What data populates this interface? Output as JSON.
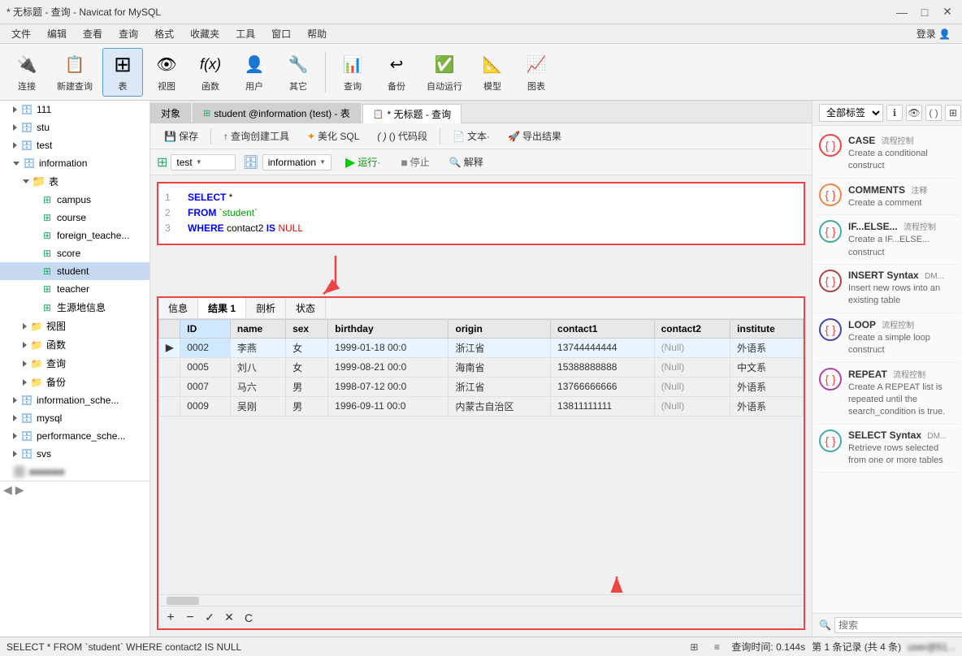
{
  "titlebar": {
    "title": "* 无标题 - 查询 - Navicat for MySQL",
    "min_btn": "—",
    "max_btn": "□",
    "close_btn": "✕"
  },
  "menubar": {
    "items": [
      "文件",
      "编辑",
      "查看",
      "查询",
      "格式",
      "收藏夹",
      "工具",
      "窗口",
      "帮助"
    ],
    "login": "登录"
  },
  "toolbar": {
    "items": [
      {
        "label": "连接",
        "icon": "🔌"
      },
      {
        "label": "新建查询",
        "icon": "📋"
      },
      {
        "label": "表",
        "icon": "⊞",
        "active": true
      },
      {
        "label": "视图",
        "icon": "👁"
      },
      {
        "label": "函数",
        "icon": "ƒ(x)"
      },
      {
        "label": "用户",
        "icon": "👤"
      },
      {
        "label": "其它",
        "icon": "🔧"
      },
      {
        "label": "查询",
        "icon": "📊"
      },
      {
        "label": "备份",
        "icon": "↩"
      },
      {
        "label": "自动运行",
        "icon": "✅"
      },
      {
        "label": "模型",
        "icon": "📐"
      },
      {
        "label": "图表",
        "icon": "📈"
      }
    ]
  },
  "sidebar": {
    "items": [
      {
        "label": "111",
        "level": 0,
        "type": "db",
        "collapsed": true
      },
      {
        "label": "stu",
        "level": 0,
        "type": "db",
        "collapsed": true
      },
      {
        "label": "test",
        "level": 0,
        "type": "db",
        "collapsed": true
      },
      {
        "label": "information",
        "level": 0,
        "type": "db",
        "collapsed": false
      },
      {
        "label": "表",
        "level": 1,
        "type": "folder",
        "collapsed": false
      },
      {
        "label": "campus",
        "level": 2,
        "type": "table"
      },
      {
        "label": "course",
        "level": 2,
        "type": "table"
      },
      {
        "label": "foreign_teache...",
        "level": 2,
        "type": "table"
      },
      {
        "label": "score",
        "level": 2,
        "type": "table"
      },
      {
        "label": "student",
        "level": 2,
        "type": "table",
        "selected": true
      },
      {
        "label": "teacher",
        "level": 2,
        "type": "table"
      },
      {
        "label": "生源地信息",
        "level": 2,
        "type": "table"
      },
      {
        "label": "视图",
        "level": 1,
        "type": "folder",
        "collapsed": true
      },
      {
        "label": "函数",
        "level": 1,
        "type": "folder",
        "collapsed": true
      },
      {
        "label": "查询",
        "level": 1,
        "type": "folder",
        "collapsed": true
      },
      {
        "label": "备份",
        "level": 1,
        "type": "folder",
        "collapsed": true
      },
      {
        "label": "information_sche...",
        "level": 0,
        "type": "db",
        "collapsed": true
      },
      {
        "label": "mysql",
        "level": 0,
        "type": "db",
        "collapsed": true
      },
      {
        "label": "performance_sche...",
        "level": 0,
        "type": "db",
        "collapsed": true
      },
      {
        "label": "svs",
        "level": 0,
        "type": "db",
        "collapsed": true
      },
      {
        "label": "...",
        "level": 0,
        "type": "more"
      }
    ]
  },
  "tabs": [
    {
      "label": "对象",
      "icon": "",
      "active": false
    },
    {
      "label": "student @information (test) - 表",
      "icon": "🟩",
      "active": false
    },
    {
      "label": "* 无标题 - 查询",
      "icon": "📋",
      "active": true
    }
  ],
  "action_bar": {
    "save": "保存",
    "query_builder": "查询创建工具",
    "beautify": "美化 SQL",
    "snippet": "() 代码段",
    "text": "文本·",
    "export": "导出结果"
  },
  "query_toolbar": {
    "db1": "test",
    "db2": "information",
    "run": "运行·",
    "stop": "停止",
    "explain": "解释"
  },
  "sql_editor": {
    "lines": [
      {
        "num": "1",
        "text": "SELECT *"
      },
      {
        "num": "2",
        "text": "FROM `student`"
      },
      {
        "num": "3",
        "text": "WHERE  contact2 IS NULL"
      }
    ]
  },
  "results_tabs": [
    "信息",
    "结果 1",
    "剖析",
    "状态"
  ],
  "results_active_tab": "结果 1",
  "table": {
    "headers": [
      "ID",
      "name",
      "sex",
      "birthday",
      "origin",
      "contact1",
      "contact2",
      "institute"
    ],
    "rows": [
      {
        "indicator": "▶",
        "id": "0002",
        "name": "李燕",
        "sex": "女",
        "birthday": "1999-01-18 00:0",
        "origin": "浙江省",
        "contact1": "13744444444",
        "contact2": "(Null)",
        "institute": "外语系"
      },
      {
        "indicator": "",
        "id": "0005",
        "name": "刘八",
        "sex": "女",
        "birthday": "1999-08-21 00:0",
        "origin": "海南省",
        "contact1": "15388888888",
        "contact2": "(Null)",
        "institute": "中文系"
      },
      {
        "indicator": "",
        "id": "0007",
        "name": "马六",
        "sex": "男",
        "birthday": "1998-07-12 00:0",
        "origin": "浙江省",
        "contact1": "13766666666",
        "contact2": "(Null)",
        "institute": "外语系"
      },
      {
        "indicator": "",
        "id": "0009",
        "name": "吴刚",
        "sex": "男",
        "birthday": "1996-09-11 00:0",
        "origin": "内蒙古自治区",
        "contact1": "13811111111",
        "contact2": "(Null)",
        "institute": "外语系"
      }
    ]
  },
  "right_panel": {
    "header_label": "全部标签",
    "snippets": [
      {
        "name": "CASE",
        "tag": "流程控制",
        "desc": "Create a conditional construct"
      },
      {
        "name": "COMMENTS",
        "tag": "注释",
        "desc": "Create a comment"
      },
      {
        "name": "IF...ELSE...",
        "tag": "流程控制",
        "desc": "Create a IF...ELSE... construct"
      },
      {
        "name": "INSERT Syntax",
        "tag": "DM...",
        "desc": "Insert new rows into an existing table"
      },
      {
        "name": "LOOP",
        "tag": "流程控制",
        "desc": "Create a simple loop construct"
      },
      {
        "name": "REPEAT",
        "tag": "流程控制",
        "desc": "Create A REPEAT list is repeated until the search_condition is true."
      },
      {
        "name": "SELECT Syntax",
        "tag": "DM...",
        "desc": "Retrieve rows selected from one or more tables"
      }
    ],
    "search_placeholder": "搜索"
  },
  "statusbar": {
    "left": "SELECT * FROM `student` WHERE  contact2 IS NULL",
    "query_time": "查询时间: 0.144s",
    "record_info": "第 1 条记录 (共 4 条)"
  },
  "table_toolbar": {
    "add": "+",
    "delete": "—",
    "check": "✓",
    "cross": "✕",
    "refresh": "C"
  }
}
